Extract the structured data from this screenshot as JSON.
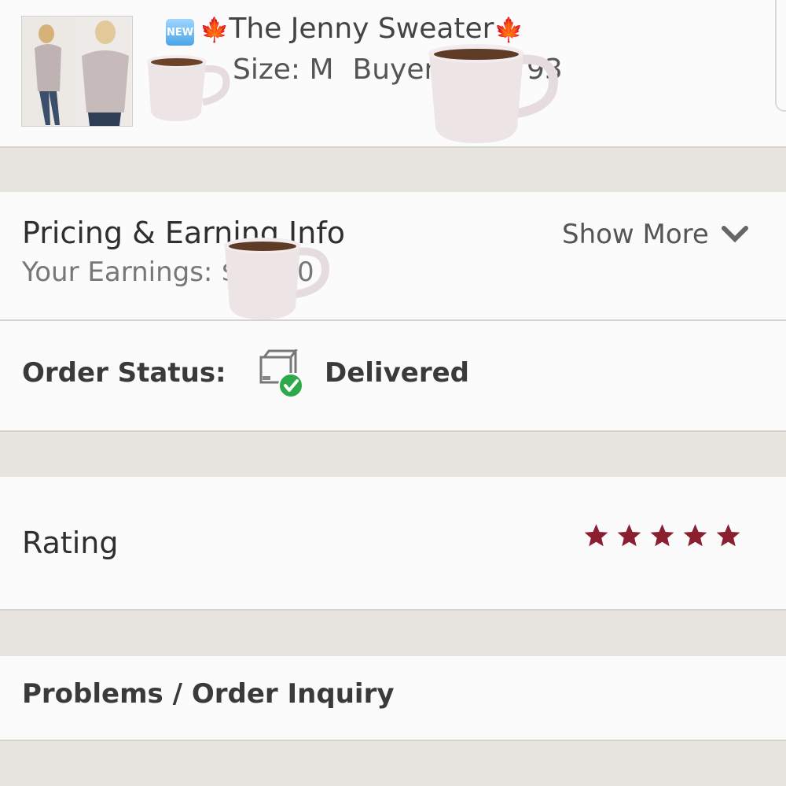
{
  "listing": {
    "new_badge": "NEW",
    "title": "The Jenny Sweater",
    "size_text": "Size: M",
    "buyer_text": "Buyer:",
    "buyer_suffix": "93"
  },
  "pricing": {
    "title": "Pricing & Earning Info",
    "earnings_text": "Your Earnings: $",
    "earnings_suffix": "0",
    "show_more": "Show More"
  },
  "status": {
    "label": "Order Status:",
    "value": "Delivered"
  },
  "rating": {
    "label": "Rating",
    "stars": 5,
    "star_color": "#8a1f2f"
  },
  "problems": {
    "label": "Problems / Order Inquiry"
  },
  "icons": {
    "status": "delivered-package-icon",
    "chevron": "chevron-down-icon",
    "leaf": "maple-leaf-icon",
    "star": "star-icon",
    "cup": "coffee-cup-icon"
  },
  "colors": {
    "background": "#e9e6e1",
    "card": "#fbfbfb",
    "check_green": "#2ea94a"
  }
}
